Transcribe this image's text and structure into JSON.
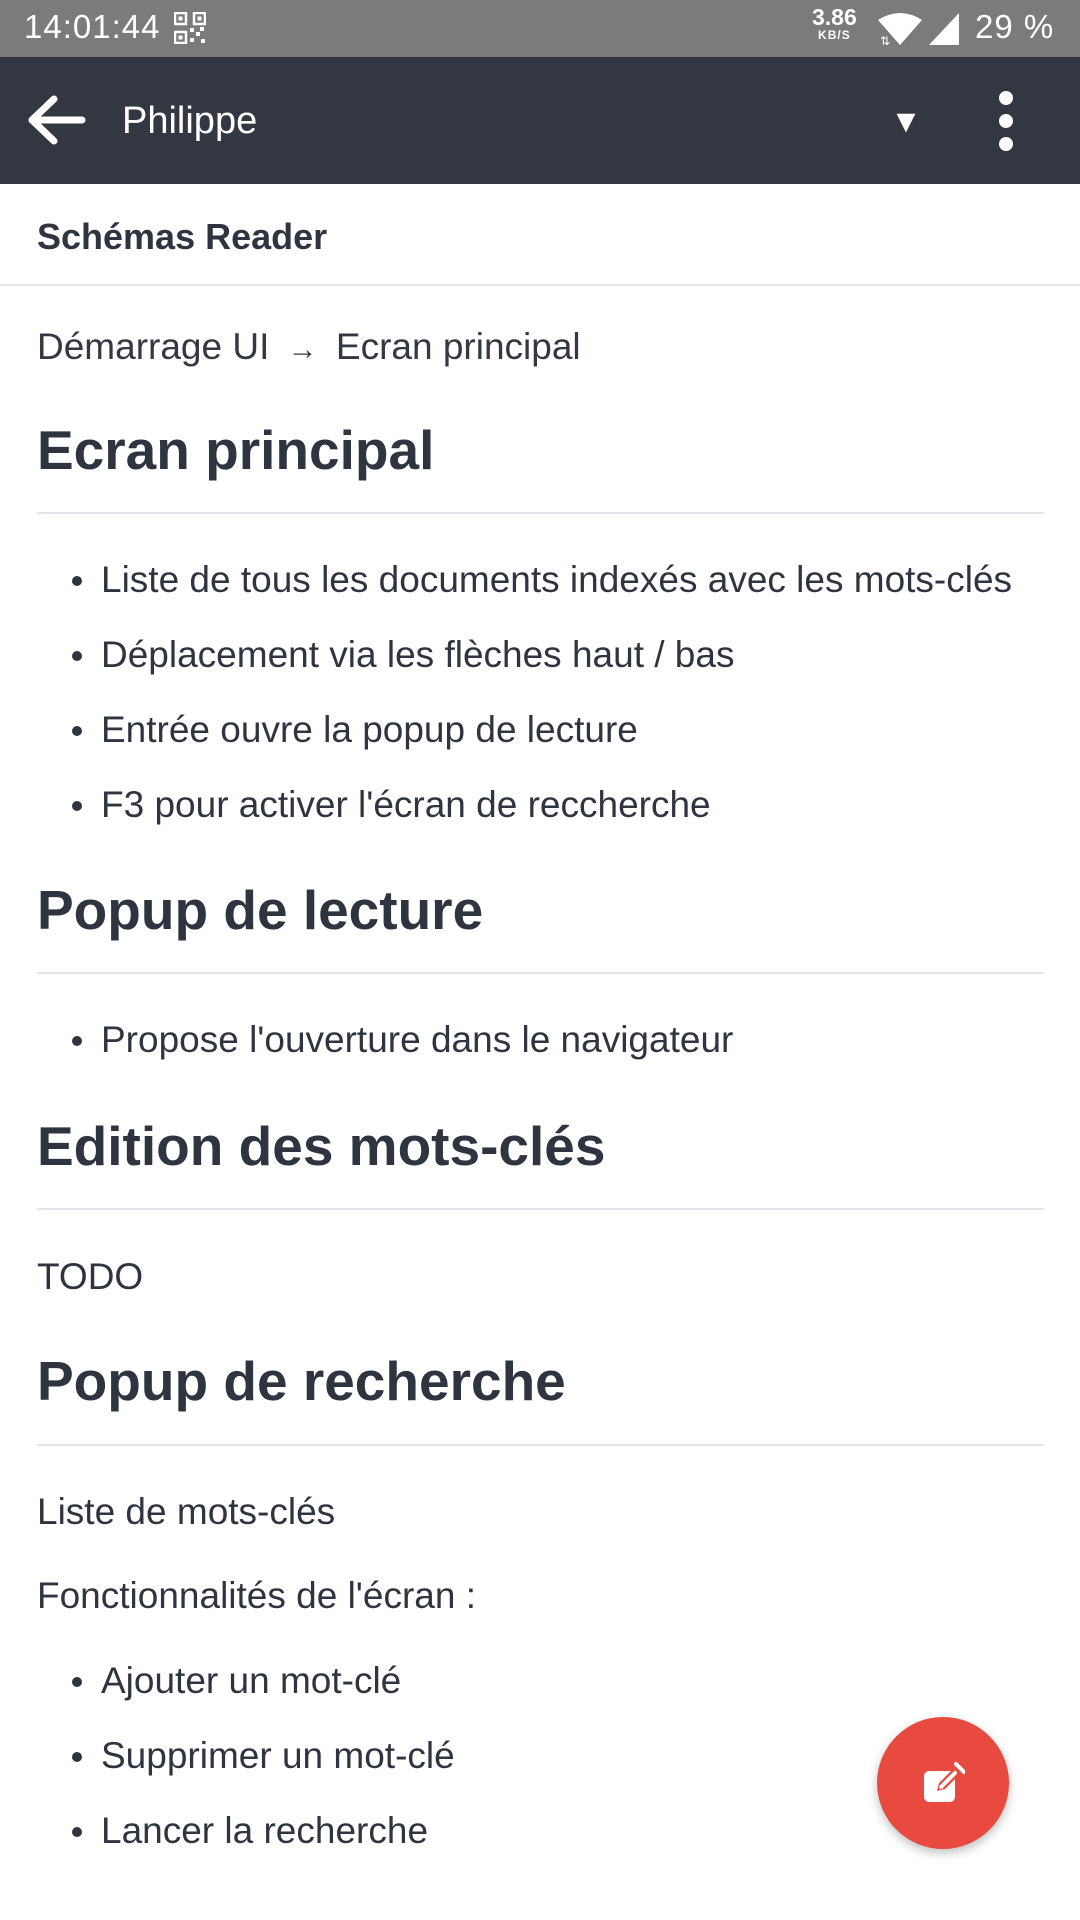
{
  "status_bar": {
    "time": "14:01:44",
    "net_speed_value": "3.86",
    "net_speed_unit": "KB/S",
    "battery": "29 %"
  },
  "app_bar": {
    "title": "Philippe",
    "dropdown_icon": "▼"
  },
  "sub_header": {
    "title": "Schémas Reader"
  },
  "breadcrumb": {
    "parent": "Démarrage UI",
    "separator": "→",
    "current": "Ecran principal"
  },
  "sections": [
    {
      "title": "Ecran principal",
      "items": [
        "Liste de tous les documents indexés avec les mots-clés",
        "Déplacement via les flèches haut / bas",
        "Entrée ouvre la popup de lecture",
        "F3 pour activer l'écran de reccherche"
      ]
    },
    {
      "title": "Popup de lecture",
      "items": [
        "Propose l'ouverture dans le navigateur"
      ]
    },
    {
      "title": "Edition des mots-clés",
      "text": "TODO"
    },
    {
      "title": "Popup de recherche",
      "paragraphs": [
        "Liste de mots-clés",
        "Fonctionnalités de l'écran :"
      ],
      "items": [
        "Ajouter un mot-clé",
        "Supprimer un mot-clé",
        "Lancer la recherche"
      ]
    }
  ],
  "icons": {
    "back": "arrow-left-icon",
    "more": "more-vertical-icon",
    "fab": "edit-icon",
    "qr": "qr-code-icon",
    "wifi": "wifi-icon",
    "signal": "signal-icon"
  },
  "colors": {
    "status_bar": "#7b7b7b",
    "app_bar": "#333742",
    "fab": "#e84a3f",
    "text": "#2f3540"
  }
}
